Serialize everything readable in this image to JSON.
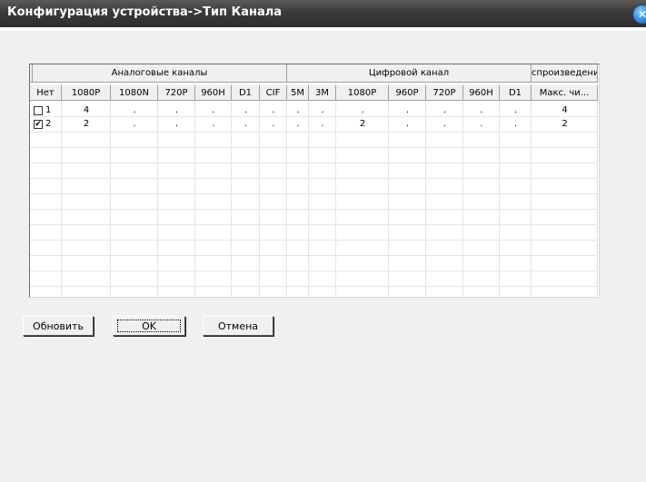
{
  "window": {
    "title": "Конфигурация устройства->Тип Канала",
    "close_icon": "close-icon"
  },
  "table": {
    "group_headers": [
      "",
      "Аналоговые каналы",
      "Цифровой канал",
      "спроизведени"
    ],
    "columns": [
      "Нет",
      "1080P",
      "1080N",
      "720P",
      "960H",
      "D1",
      "CIF",
      "5M",
      "3M",
      "1080P",
      "960P",
      "720P",
      "960H",
      "D1",
      "Макс. чи..."
    ],
    "rows": [
      {
        "num": "1",
        "checked": false,
        "cells": [
          "4",
          ".",
          ".",
          ".",
          ".",
          ".",
          ".",
          ".",
          ".",
          ".",
          ".",
          ".",
          ".",
          "4"
        ]
      },
      {
        "num": "2",
        "checked": true,
        "cells": [
          "2",
          ".",
          ".",
          ".",
          ".",
          ".",
          ".",
          ".",
          "2",
          ".",
          ".",
          ".",
          ".",
          "2"
        ]
      }
    ]
  },
  "buttons": {
    "refresh": "Обновить",
    "ok": "OK",
    "cancel": "Отмена"
  }
}
